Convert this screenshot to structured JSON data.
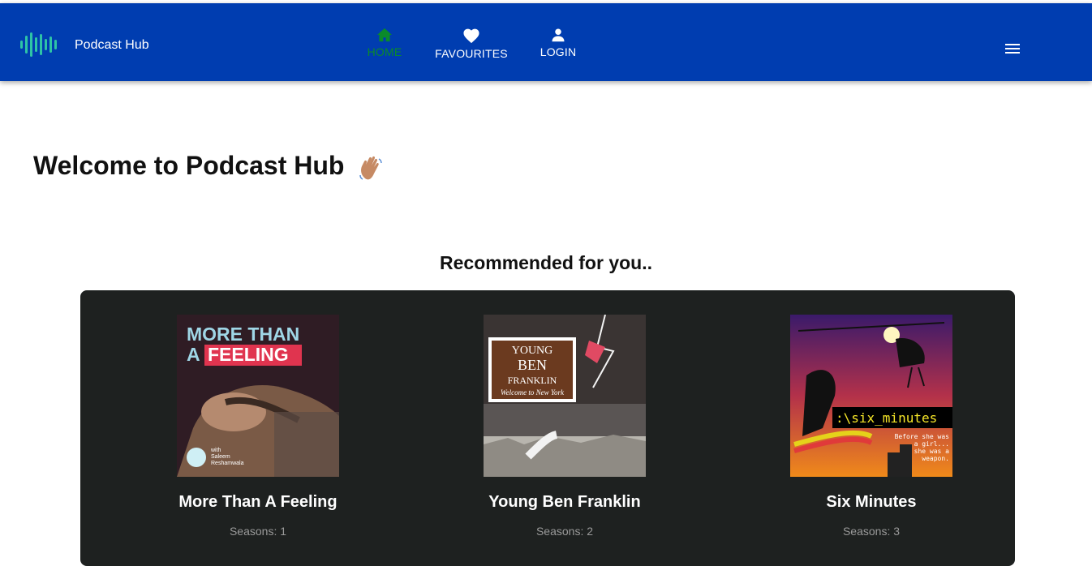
{
  "header": {
    "brand": "Podcast Hub",
    "nav": [
      {
        "label": "HOME",
        "icon": "home-icon",
        "active": true
      },
      {
        "label": "FAVOURITES",
        "icon": "heart-icon",
        "active": false
      },
      {
        "label": "LOGIN",
        "icon": "person-icon",
        "active": false
      }
    ],
    "menu_icon": "hamburger-menu-icon"
  },
  "main": {
    "welcome": "Welcome to Podcast Hub",
    "wave_icon": "waving-hand-icon",
    "recommended_title": "Recommended for you.."
  },
  "carousel": {
    "items": [
      {
        "title": "More Than A Feeling",
        "seasons": "Seasons: 1",
        "cover_text": {
          "line1": "MORE THAN",
          "line2a": "A",
          "line2b": "FEELING",
          "with": "with",
          "host1": "Saleem",
          "host2": "Reshamwala"
        }
      },
      {
        "title": "Young Ben Franklin",
        "seasons": "Seasons: 2",
        "cover_text": {
          "line1": "YOUNG",
          "line2": "BEN",
          "line3": "FRANKLIN",
          "line4": "Welcome to New York"
        }
      },
      {
        "title": "Six Minutes",
        "seasons": "Seasons: 3",
        "cover_text": {
          "line1": ":\\six_minutes",
          "line2": "Before she was",
          "line3": "a girl...",
          "line4": "she was a",
          "line5": "weapon."
        }
      }
    ]
  },
  "colors": {
    "header_bg": "#003db0",
    "active_nav": "#0a8a2a",
    "carousel_bg": "#1e2120",
    "seasons_text": "#9a9a9a"
  }
}
